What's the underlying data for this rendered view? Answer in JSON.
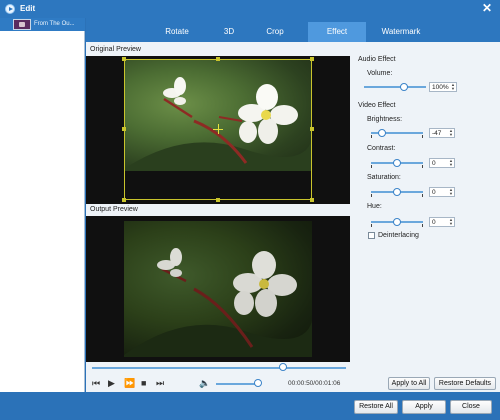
{
  "window": {
    "title": "Edit",
    "close_glyph": "✕"
  },
  "file_list": {
    "items": [
      {
        "name": "From The Ou..."
      }
    ]
  },
  "tabs": [
    {
      "label": "Rotate",
      "active": false
    },
    {
      "label": "3D",
      "active": false
    },
    {
      "label": "Crop",
      "active": false
    },
    {
      "label": "Effect",
      "active": true
    },
    {
      "label": "Watermark",
      "active": false
    }
  ],
  "preview": {
    "original_label": "Original Preview",
    "output_label": "Output Preview",
    "seek_position": 0.75,
    "time": "00:00:50/00:01:06",
    "volume_level": 0.85
  },
  "effects": {
    "audio_heading": "Audio Effect",
    "volume_label": "Volume:",
    "volume_value": "100%",
    "video_heading": "Video Effect",
    "brightness_label": "Brightness:",
    "brightness_value": "-47",
    "contrast_label": "Contrast:",
    "contrast_value": "0",
    "saturation_label": "Saturation:",
    "saturation_value": "0",
    "hue_label": "Hue:",
    "hue_value": "0",
    "deinterlacing_label": "Deinterlacing",
    "deinterlacing_checked": false
  },
  "buttons": {
    "apply_to_all": "Apply to All",
    "restore_defaults": "Restore Defaults",
    "restore_all": "Restore All",
    "apply": "Apply",
    "close": "Close"
  },
  "colors": {
    "accent": "#2d77bf",
    "active_tab": "#4f99de",
    "crop_frame": "#c9c42c"
  }
}
